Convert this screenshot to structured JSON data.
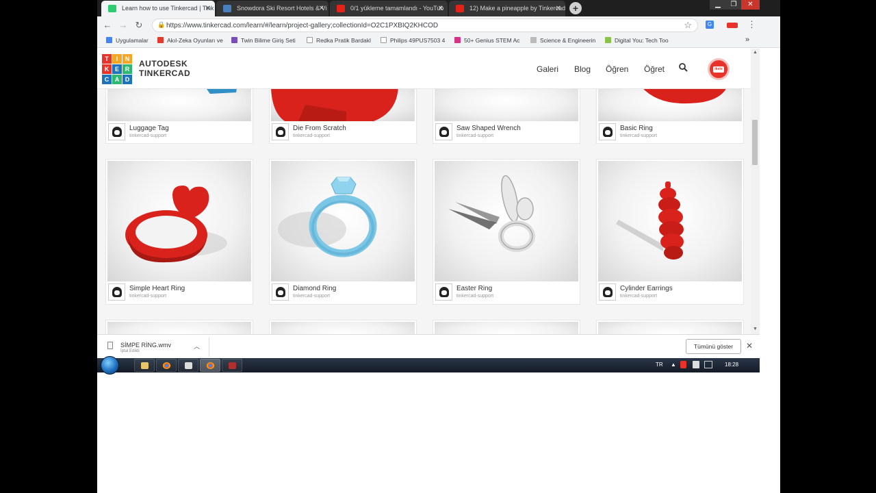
{
  "tabs": [
    {
      "title": "Learn how to use Tinkercad | Tink",
      "active": true,
      "color": "#2ecc71"
    },
    {
      "title": "Snowdora Ski Resort Hotels & Vi",
      "active": false,
      "color": "#4a7fbf"
    },
    {
      "title": "0/1 yükleme tamamlandı - YouTub",
      "active": false,
      "color": "#e62117"
    },
    {
      "title": "12) Make a pineapple by Tinkercad",
      "active": false,
      "color": "#e62117"
    }
  ],
  "address": {
    "url": "https://www.tinkercad.com/learn/#/learn/project-gallery;collectionId=O2C1PXBIQ2KHCOD"
  },
  "bookmarks": [
    {
      "label": "Uygulamalar",
      "color": "#4285f4"
    },
    {
      "label": "Akıl-Zeka Oyunları ve",
      "color": "#e23b2e"
    },
    {
      "label": "Twin Bilime Giriş Seti",
      "color": "#7a4fb5"
    },
    {
      "label": "Redka Pratik Bardakl",
      "color": "#999999"
    },
    {
      "label": "Philips 49PUS7503 4",
      "color": "#999999"
    },
    {
      "label": "50+ Genius STEM Ac",
      "color": "#d63384"
    },
    {
      "label": "Science & Engineerin",
      "color": "#bbbbbb"
    },
    {
      "label": "Digital You: Tech Too",
      "color": "#8bc34a"
    }
  ],
  "site": {
    "logo_letters": [
      "T",
      "I",
      "N",
      "K",
      "E",
      "R",
      "C",
      "A",
      "D"
    ],
    "logo_colors": [
      "#e8332a",
      "#f5a623",
      "#f5a623",
      "#e8332a",
      "#1c75bc",
      "#2eb872",
      "#1c75bc",
      "#2eb872",
      "#1c75bc"
    ],
    "brand_line1": "AUTODESK",
    "brand_line2": "TINKERCAD",
    "nav": [
      "Galeri",
      "Blog",
      "Öğren",
      "Öğret"
    ],
    "avatar_text": "ikeln"
  },
  "cards_row1": [
    {
      "title": "Luggage Tag",
      "author": "tinkercad-support"
    },
    {
      "title": "Die From Scratch",
      "author": "tinkercad-support"
    },
    {
      "title": "Saw Shaped Wrench",
      "author": "tinkercad-support"
    },
    {
      "title": "Basic Ring",
      "author": "tinkercad-support"
    }
  ],
  "cards_row2": [
    {
      "title": "Simple Heart Ring",
      "author": "tinkercad-support"
    },
    {
      "title": "Diamond Ring",
      "author": "tinkercad-support"
    },
    {
      "title": "Easter Ring",
      "author": "tinkercad-support"
    },
    {
      "title": "Cylinder Earrings",
      "author": "tinkercad-support"
    }
  ],
  "download": {
    "filename": "SİMPE RİNG.wmv",
    "status": "İptal Edildi",
    "show_all": "Tümünü göster"
  },
  "taskbar": {
    "lang": "TR",
    "time": "18:28"
  },
  "colors": {
    "accent_red": "#e8332a",
    "ring_blue": "#7cc6e6"
  }
}
